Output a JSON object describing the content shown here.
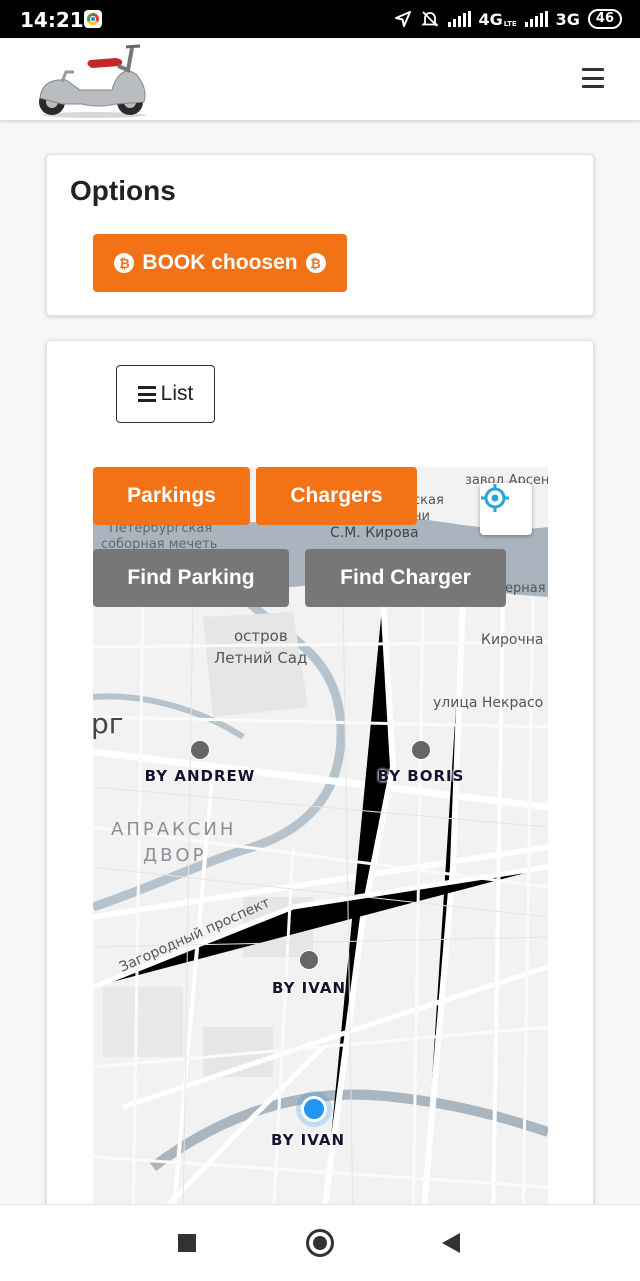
{
  "status_bar": {
    "time": "14:21",
    "network_1": "4G",
    "network_1_sub": "LTE",
    "network_2": "3G",
    "battery": "46"
  },
  "header": {
    "logo_icon": "scooter-logo",
    "menu_icon": "hamburger-menu-icon"
  },
  "options": {
    "title": "Options",
    "book_label": "BOOK choosen",
    "book_icon": "bitcoin-icon",
    "book_color": "#f47216"
  },
  "controls": {
    "list_label": "List",
    "parkings_label": "Parkings",
    "chargers_label": "Chargers",
    "find_parking_label": "Find Parking",
    "find_charger_label": "Find Charger",
    "orange": "#f47216",
    "gray": "#777777"
  },
  "map": {
    "labels": {
      "zavod": "завод Арсен",
      "akaya": "ская",
      "ni": "ни",
      "kirova": "С.М. Кирова",
      "mosque_1": "Петербургская",
      "mosque_2": "соборная мечеть",
      "ernaya": "ерная",
      "ostrov": "остров",
      "letniy_sad": "Летний Сад",
      "kirochnaya": "Кирочна",
      "nekrasova": "улица Некрасо",
      "rg": "рг",
      "apraksin_1": "АПРАКСИН",
      "apraksin_2": "ДВОР",
      "zagorodny": "Загородный проспект"
    },
    "markers": [
      "BY ANDREW",
      "BY BORIS",
      "BY IVAN",
      "BY IVAN"
    ],
    "user_location_color": "#2196f3"
  },
  "nav_bar": {
    "recents_icon": "square-recents-icon",
    "home_icon": "circle-home-icon",
    "back_icon": "triangle-back-icon"
  }
}
